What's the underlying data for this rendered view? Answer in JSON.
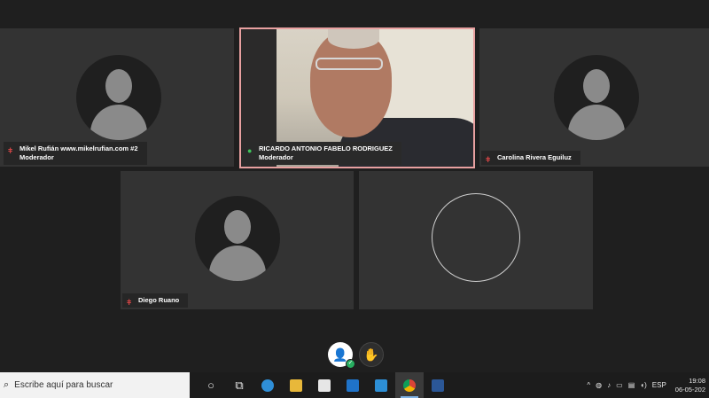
{
  "participants": [
    {
      "name_line1": "Mikel Rufián www.mikelrufian.com #2",
      "name_line2": "Moderador",
      "mic_icon": "mic-muted-icon"
    },
    {
      "name_line1": "RICARDO ANTONIO FABELO RODRIGUEZ",
      "name_line2": "Moderador",
      "mic_icon": "mic-on-icon"
    },
    {
      "name_line1": "Carolina Rivera Eguiluz",
      "name_line2": "",
      "mic_icon": "mic-muted-icon"
    },
    {
      "name_line1": "Diego Ruano",
      "name_line2": "",
      "mic_icon": "mic-muted-icon"
    }
  ],
  "colors": {
    "active_speaker_border": "#e8a0a0",
    "mic_muted": "#d64545",
    "mic_on": "#3fc45a",
    "presence_available": "#27ae60"
  },
  "taskbar": {
    "search_placeholder": "Escribe aquí para buscar",
    "tray_language": "ESP",
    "clock_time": "19:08",
    "clock_date": "06-05-202"
  }
}
